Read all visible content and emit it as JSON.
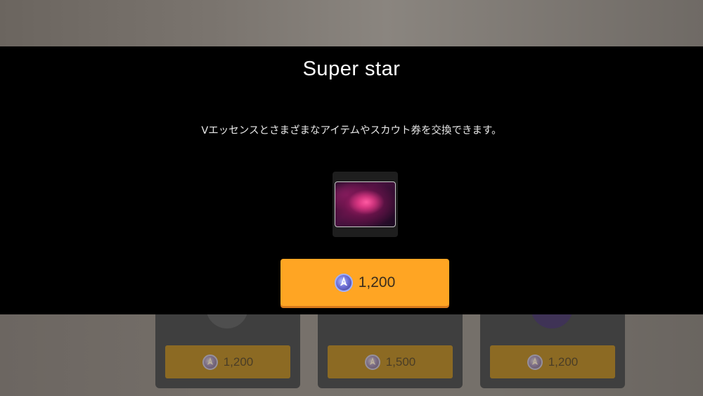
{
  "modal": {
    "title": "Super star",
    "description": "Vエッセンスとさまざまなアイテムやスカウト券を交換できます。",
    "item_icon": "nebula-image",
    "price": "1,200",
    "currency_icon": "v-essence-coin-icon",
    "button_color": "#ffa523"
  },
  "background_shop": {
    "cards": [
      {
        "price": "1,200"
      },
      {
        "price": "1,500"
      },
      {
        "price": "1,200"
      }
    ]
  }
}
